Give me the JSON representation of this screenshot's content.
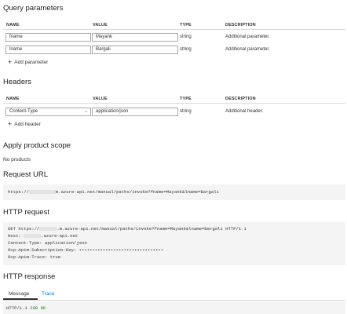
{
  "query": {
    "title": "Query parameters",
    "columns": [
      "NAME",
      "VALUE",
      "TYPE",
      "DESCRIPTION"
    ],
    "rows": [
      {
        "name": "fname",
        "value": "Mayank",
        "type": "string",
        "description": "Additional parameter."
      },
      {
        "name": "lname",
        "value": "Bargali",
        "type": "string",
        "description": "Additional parameter."
      }
    ],
    "add_label": "Add parameter"
  },
  "headers": {
    "title": "Headers",
    "columns": [
      "NAME",
      "VALUE",
      "TYPE",
      "DESCRIPTION"
    ],
    "rows": [
      {
        "name": "Content-Type",
        "value": "application/json",
        "type": "string",
        "description": "Additional header."
      }
    ],
    "add_label": "Add header"
  },
  "scope": {
    "title": "Apply product scope",
    "value": "No products"
  },
  "request_url": {
    "title": "Request URL",
    "prefix": "https://",
    "suffix": "m.azure-api.net/manual/paths/invoke?fname=Mayank&lname=Bargali"
  },
  "http_request": {
    "title": "HTTP request",
    "line1_prefix": "GET https://",
    "line1_suffix": ".m.azure-api.net/manual/paths/invoke?fname=Mayank&lname=Bargali HTTP/1.1",
    "line2_prefix": "Host: ",
    "line2_suffix": ".azure-api.net",
    "line3": "Content-Type: application/json",
    "line4": "Ocp-Apim-Subscription-Key: ••••••••••••••••••••••••••••••••",
    "line5": "Ocp-Apim-Trace: true"
  },
  "http_response": {
    "title": "HTTP response",
    "tabs": [
      "Message",
      "Trace"
    ],
    "status_proto": "HTTP/1.1",
    "status_code": "200",
    "status_text": "OK"
  },
  "colors": {
    "accent": "#0078d4",
    "status_green": "#107c10",
    "code_bg": "#f4f4f4"
  }
}
